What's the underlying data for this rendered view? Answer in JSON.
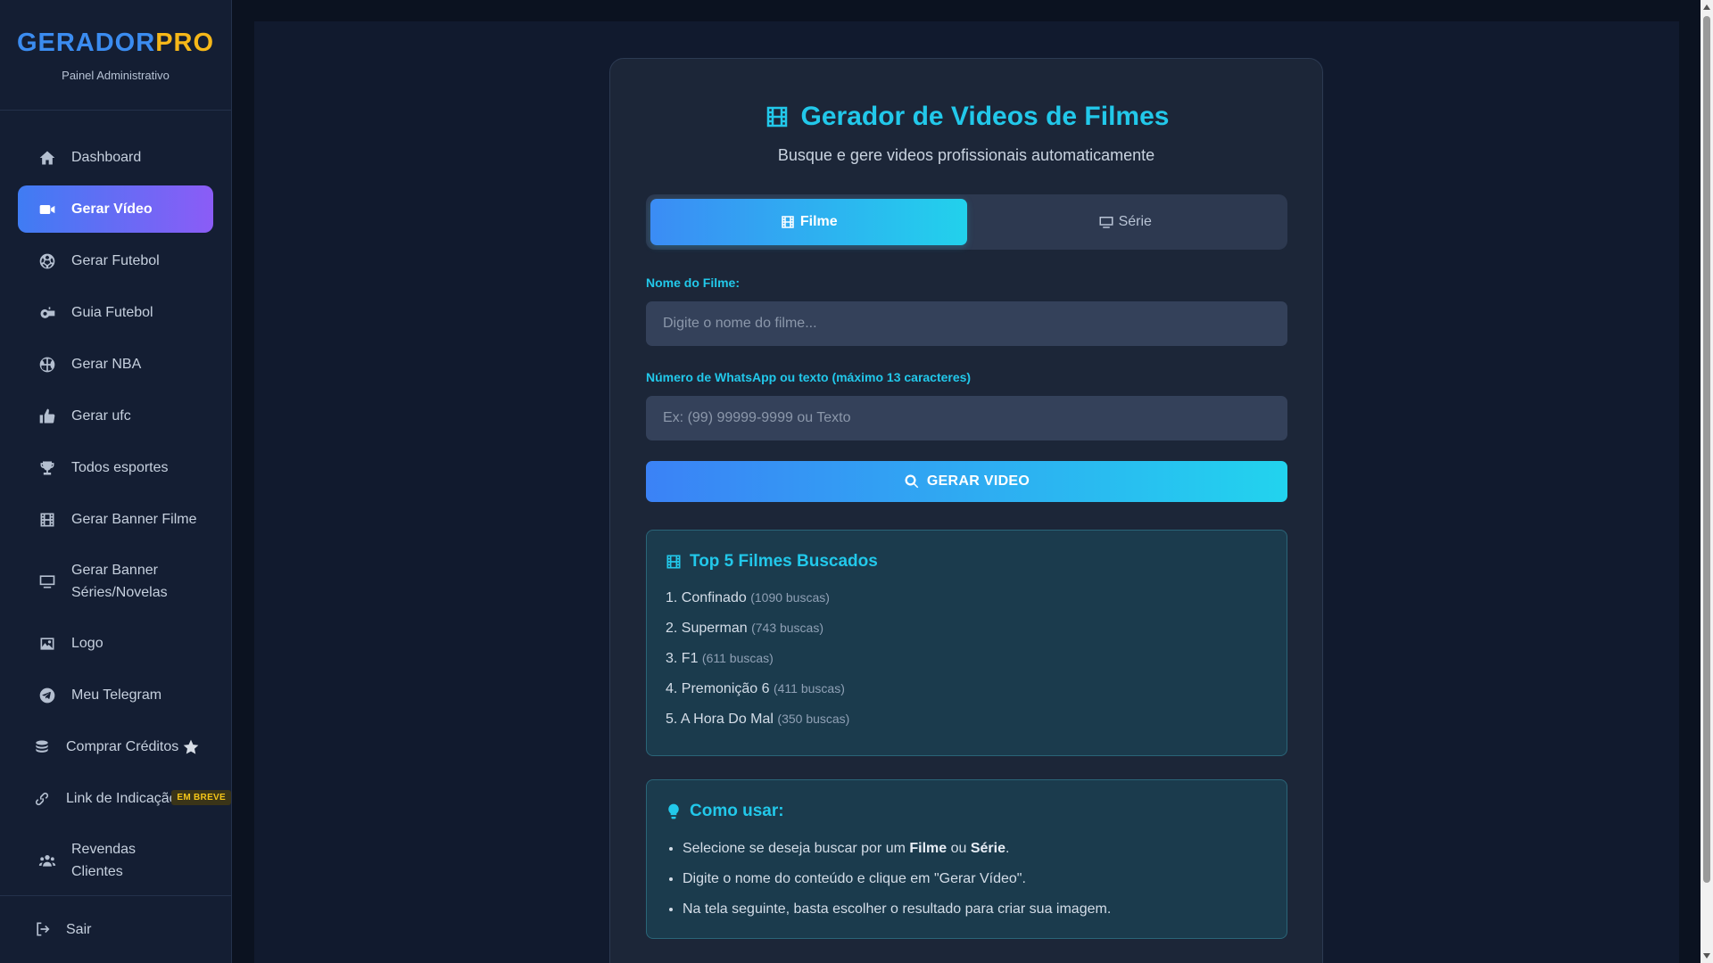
{
  "brand": {
    "part1": "GERADOR",
    "part2": "PRO",
    "subtitle": "Painel Administrativo"
  },
  "sidebar": {
    "items": [
      {
        "label": "Dashboard",
        "icon": "home-icon"
      },
      {
        "label": "Gerar Vídeo",
        "icon": "video-camera-icon",
        "active": true
      },
      {
        "label": "Gerar Futebol",
        "icon": "soccer-ball-icon"
      },
      {
        "label": "Guia Futebol",
        "icon": "whistle-icon"
      },
      {
        "label": "Gerar NBA",
        "icon": "basketball-icon"
      },
      {
        "label": "Gerar ufc",
        "icon": "thumbs-up-icon"
      },
      {
        "label": "Todos esportes",
        "icon": "trophy-icon"
      },
      {
        "label": "Gerar Banner Filme",
        "icon": "film-icon"
      },
      {
        "label": "Gerar Banner Séries/Novelas",
        "label_line1": "Gerar Banner",
        "label_line2": "Séries/Novelas",
        "icon": "tv-icon"
      },
      {
        "label": "Logo",
        "icon": "image-icon"
      },
      {
        "label": "Meu Telegram",
        "icon": "telegram-icon"
      },
      {
        "label": "Comprar Créditos",
        "icon": "coins-icon",
        "badge_icon": "star-icon"
      },
      {
        "label": "Link de Indicação",
        "icon": "link-icon",
        "badge": "EM BREVE"
      },
      {
        "label": "Revendas Clientes",
        "label_line1": "Revendas",
        "label_line2": "Clientes",
        "icon": "users-icon"
      }
    ],
    "logout": {
      "label": "Sair",
      "icon": "sign-out-icon"
    }
  },
  "main": {
    "title": "Gerador de Videos de Filmes",
    "title_icon": "film-icon",
    "subtitle": "Busque e gere videos profissionais automaticamente",
    "tabs": [
      {
        "label": "Filme",
        "icon": "film-icon",
        "active": true
      },
      {
        "label": "Série",
        "icon": "tv-icon"
      }
    ],
    "movie_field": {
      "label": "Nome do Filme:",
      "placeholder": "Digite o nome do filme...",
      "value": ""
    },
    "whatsapp_field": {
      "label": "Número de WhatsApp ou texto (máximo 13 caracteres)",
      "placeholder": "Ex: (99) 99999-9999 ou Texto",
      "value": ""
    },
    "generate_button": {
      "label": "GERAR VIDEO",
      "icon": "search-icon"
    },
    "top5": {
      "title": "Top 5 Filmes Buscados",
      "icon": "film-icon",
      "items": [
        {
          "rank": "1.",
          "name": "Confinado",
          "count": "(1090 buscas)"
        },
        {
          "rank": "2.",
          "name": "Superman",
          "count": "(743 buscas)"
        },
        {
          "rank": "3.",
          "name": "F1",
          "count": "(611 buscas)"
        },
        {
          "rank": "4.",
          "name": "Premonição 6",
          "count": "(411 buscas)"
        },
        {
          "rank": "5.",
          "name": "A Hora Do Mal",
          "count": "(350 buscas)"
        }
      ]
    },
    "how_to": {
      "title": "Como usar:",
      "icon": "lightbulb-icon",
      "line1": {
        "pre": "Selecione se deseja buscar por um ",
        "bold1": "Filme",
        "mid": " ou ",
        "bold2": "Série",
        "post": "."
      },
      "line2": "Digite o nome do conteúdo e clique em \"Gerar Vídeo\".",
      "line3": "Na tela seguinte, basta escolher o resultado para criar sua imagem."
    }
  },
  "colors": {
    "accent": "#22c8ea",
    "brand_blue": "#3b8cf0",
    "brand_gold": "#f5b719",
    "active_gradient_start": "#3f7cf3",
    "active_gradient_end": "#8b5cf6"
  }
}
